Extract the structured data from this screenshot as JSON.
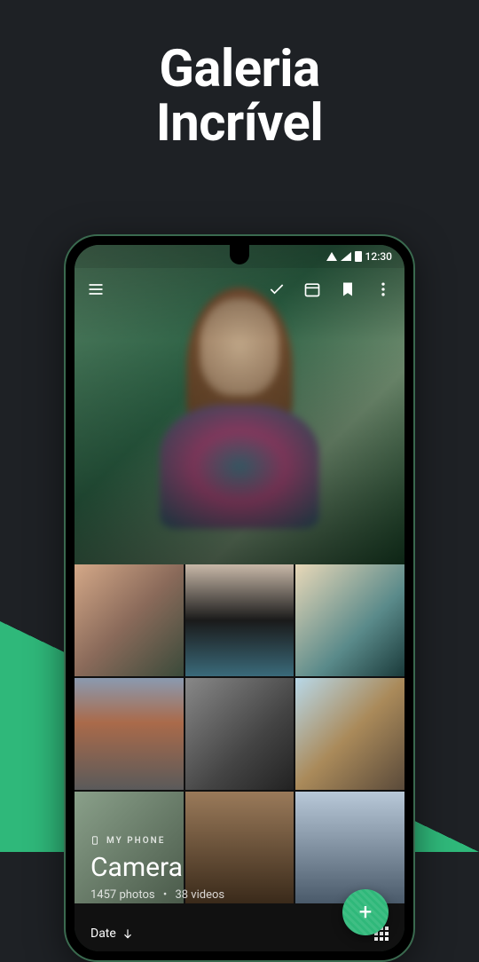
{
  "headline": {
    "line1": "Galeria",
    "line2": "Incrível"
  },
  "statusbar": {
    "time": "12:30"
  },
  "album": {
    "location_label": "MY PHONE",
    "title": "Camera",
    "photos_count": "1457 photos",
    "sep": "•",
    "videos_count": "38 videos"
  },
  "sort": {
    "label": "Date"
  },
  "fab": {
    "glyph": "+"
  }
}
